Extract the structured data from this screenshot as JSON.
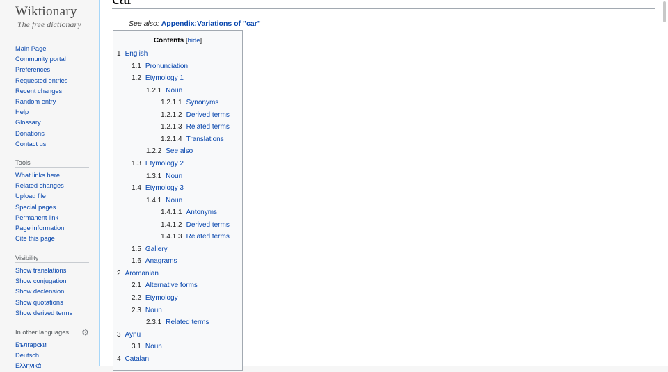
{
  "logo": {
    "title": "Wiktionary",
    "tagline": "The free dictionary"
  },
  "navigation": [
    "Main Page",
    "Community portal",
    "Preferences",
    "Requested entries",
    "Recent changes",
    "Random entry",
    "Help",
    "Glossary",
    "Donations",
    "Contact us"
  ],
  "tools": {
    "heading": "Tools",
    "items": [
      "What links here",
      "Related changes",
      "Upload file",
      "Special pages",
      "Permanent link",
      "Page information",
      "Cite this page"
    ]
  },
  "visibility": {
    "heading": "Visibility",
    "items": [
      "Show translations",
      "Show conjugation",
      "Show declension",
      "Show quotations",
      "Show derived terms"
    ]
  },
  "languages": {
    "heading": "In other languages",
    "items": [
      "Български",
      "Deutsch",
      "Ελληνικά"
    ]
  },
  "page": {
    "title": "car",
    "see_also_prefix": "See also:",
    "see_also_link": "Appendix:Variations of \"car\""
  },
  "toc": {
    "heading": "Contents",
    "hide_open": "[",
    "hide_label": "hide",
    "hide_close": "]",
    "items": [
      {
        "num": "1",
        "text": "English",
        "level": 1
      },
      {
        "num": "1.1",
        "text": "Pronunciation",
        "level": 2
      },
      {
        "num": "1.2",
        "text": "Etymology 1",
        "level": 2
      },
      {
        "num": "1.2.1",
        "text": "Noun",
        "level": 3
      },
      {
        "num": "1.2.1.1",
        "text": "Synonyms",
        "level": 4
      },
      {
        "num": "1.2.1.2",
        "text": "Derived terms",
        "level": 4
      },
      {
        "num": "1.2.1.3",
        "text": "Related terms",
        "level": 4
      },
      {
        "num": "1.2.1.4",
        "text": "Translations",
        "level": 4
      },
      {
        "num": "1.2.2",
        "text": "See also",
        "level": 3
      },
      {
        "num": "1.3",
        "text": "Etymology 2",
        "level": 2
      },
      {
        "num": "1.3.1",
        "text": "Noun",
        "level": 3
      },
      {
        "num": "1.4",
        "text": "Etymology 3",
        "level": 2
      },
      {
        "num": "1.4.1",
        "text": "Noun",
        "level": 3
      },
      {
        "num": "1.4.1.1",
        "text": "Antonyms",
        "level": 4
      },
      {
        "num": "1.4.1.2",
        "text": "Derived terms",
        "level": 4
      },
      {
        "num": "1.4.1.3",
        "text": "Related terms",
        "level": 4
      },
      {
        "num": "1.5",
        "text": "Gallery",
        "level": 2
      },
      {
        "num": "1.6",
        "text": "Anagrams",
        "level": 2
      },
      {
        "num": "2",
        "text": "Aromanian",
        "level": 1
      },
      {
        "num": "2.1",
        "text": "Alternative forms",
        "level": 2
      },
      {
        "num": "2.2",
        "text": "Etymology",
        "level": 2
      },
      {
        "num": "2.3",
        "text": "Noun",
        "level": 2
      },
      {
        "num": "2.3.1",
        "text": "Related terms",
        "level": 3
      },
      {
        "num": "3",
        "text": "Aynu",
        "level": 1
      },
      {
        "num": "3.1",
        "text": "Noun",
        "level": 2
      },
      {
        "num": "4",
        "text": "Catalan",
        "level": 1
      }
    ]
  }
}
